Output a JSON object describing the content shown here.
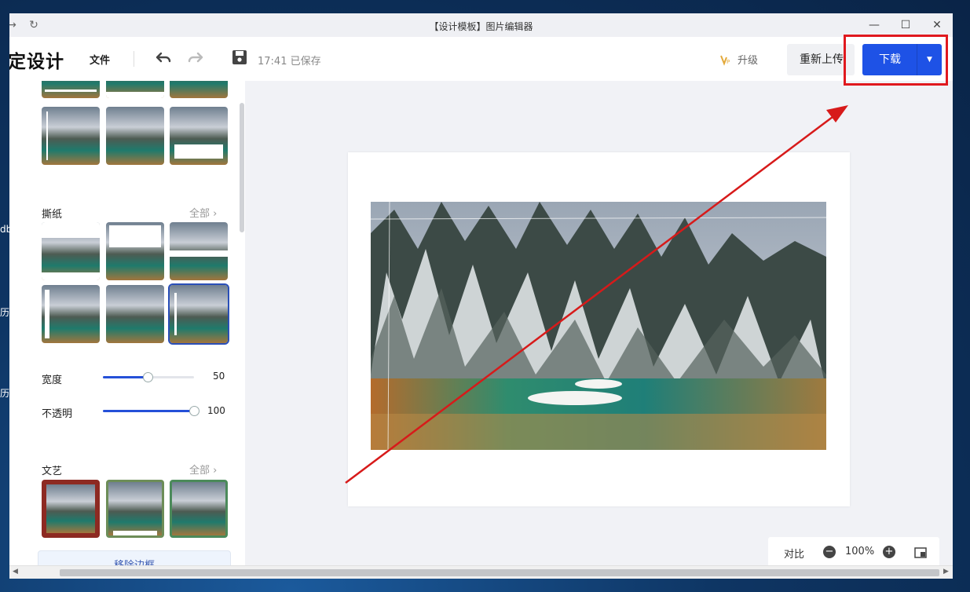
{
  "window": {
    "title": "【设计模板】图片编辑器"
  },
  "toolbar": {
    "app_title": "定设计",
    "file_menu": "文件",
    "save_status": "17:41 已保存",
    "upgrade_label": "升级",
    "reupload_label": "重新上传",
    "download_label": "下载"
  },
  "panel": {
    "torn_paper_section": "撕纸",
    "torn_paper_all": "全部",
    "width_label": "宽度",
    "width_value": 50,
    "opacity_label": "不透明",
    "opacity_value": 100,
    "art_section": "文艺",
    "art_all": "全部",
    "remove_frame": "移除边框"
  },
  "zoom": {
    "contrast_label": "对比",
    "zoom_level": "100%"
  },
  "desktop": {
    "fragments": [
      "db",
      "历",
      "历"
    ]
  },
  "colors": {
    "accent": "#1e52e6",
    "highlight": "#e0191e",
    "annotation_arrow": "#d71a1a"
  }
}
